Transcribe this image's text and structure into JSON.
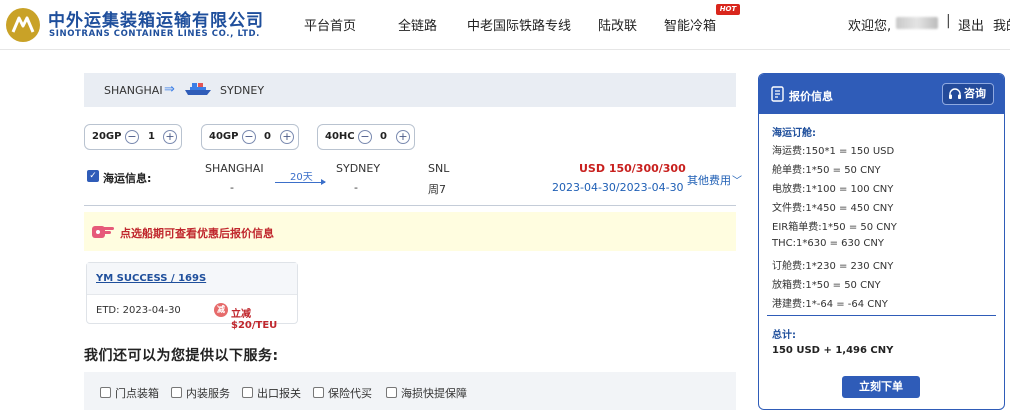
{
  "brand": {
    "name_cn": "中外运集装箱运输有限公司",
    "name_en": "SINOTRANS CONTAINER LINES CO., LTD."
  },
  "nav": {
    "items": [
      "平台首页",
      "全链路",
      "中老国际铁路专线",
      "陆改联",
      "智能冷箱"
    ],
    "hot_badge": "HOT"
  },
  "user": {
    "welcome": "欢迎您,",
    "separator": "|",
    "logout": "退出",
    "mine": "我的"
  },
  "route": {
    "from": "SHANGHAI",
    "to": "SYDNEY"
  },
  "containers": [
    {
      "type": "20GP",
      "qty": "1"
    },
    {
      "type": "40GP",
      "qty": "0"
    },
    {
      "type": "40HC",
      "qty": "0"
    }
  ],
  "schedule": {
    "label": "海运信息:",
    "origin": "SHANGHAI",
    "origin_sub": "-",
    "transit": "20天",
    "destination": "SYDNEY",
    "destination_sub": "-",
    "service": "SNL",
    "weekday": "周7",
    "price": "USD 150/300/300",
    "date_range": "2023-04-30/2023-04-30",
    "other_fees": "其他费用"
  },
  "notice": {
    "text": "点选船期可查看优惠后报价信息"
  },
  "vessel": {
    "name": "YM SUCCESS / 169S",
    "etd": "ETD: 2023-04-30",
    "discount": "立减$20/TEU"
  },
  "services": {
    "title": "我们还可以为您提供以下服务:",
    "items": [
      "门点装箱",
      "内装服务",
      "出口报关",
      "保险代买",
      "海损快提保障"
    ]
  },
  "quote": {
    "title": "报价信息",
    "consult": "咨询",
    "section_ocean": "海运订舱:",
    "lines": [
      "海运费:150*1 = 150 USD",
      "舱单费:1*50 = 50 CNY",
      "电放费:1*100 = 100 CNY",
      "文件费:1*450 = 450 CNY",
      "EIR箱单费:1*50 = 50 CNY",
      "THC:1*630 = 630 CNY",
      "订舱费:1*230 = 230 CNY",
      "放箱费:1*50 = 50 CNY",
      "港建费:1*-64 = -64 CNY"
    ],
    "section_total": "总计:",
    "total": "150 USD + 1,496 CNY",
    "order_button": "立刻下单"
  },
  "colors": {
    "brand_blue": "#2f5cb8",
    "price_red": "#c8201e",
    "notice_bg": "#fffde0",
    "route_bar_bg": "#e9edf3"
  }
}
